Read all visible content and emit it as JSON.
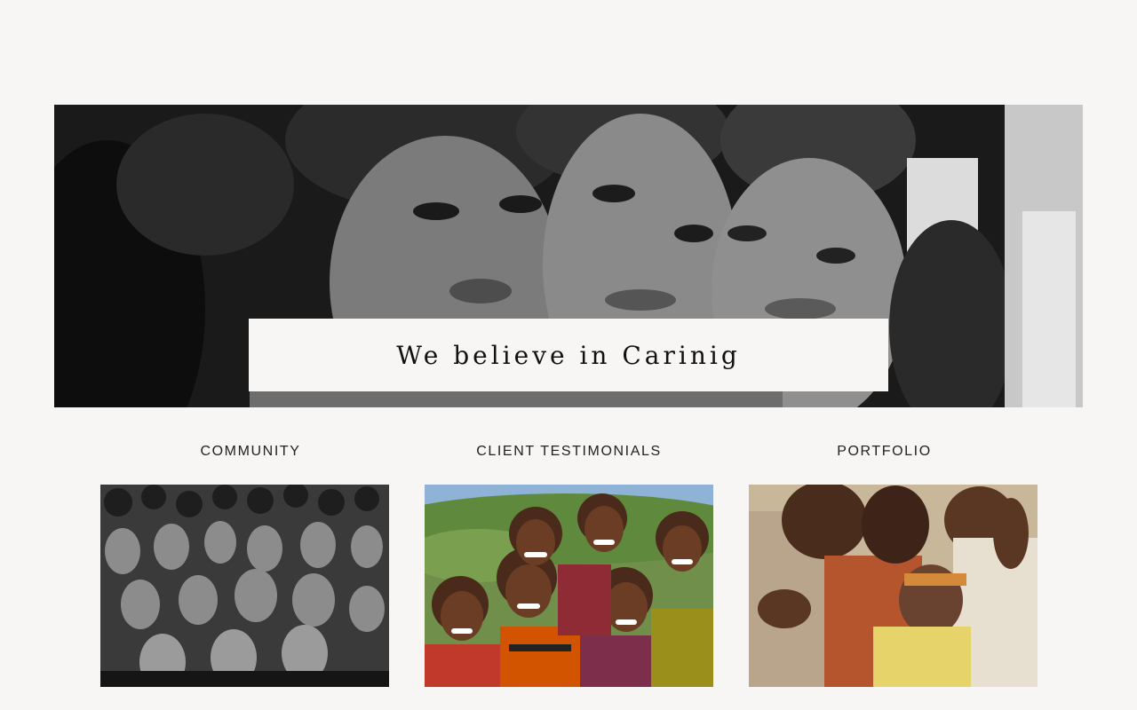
{
  "hero": {
    "caption": "We believe in Carinig",
    "image_icon": "children-faces-photo"
  },
  "sections": [
    {
      "title": "COMMUNITY",
      "image_icon": "crowd-photo"
    },
    {
      "title": "CLIENT TESTIMONIALS",
      "image_icon": "smiling-children-photo"
    },
    {
      "title": "PORTFOLIO",
      "image_icon": "family-hug-photo"
    }
  ],
  "colors": {
    "background": "#f7f6f5",
    "text": "#111111"
  }
}
